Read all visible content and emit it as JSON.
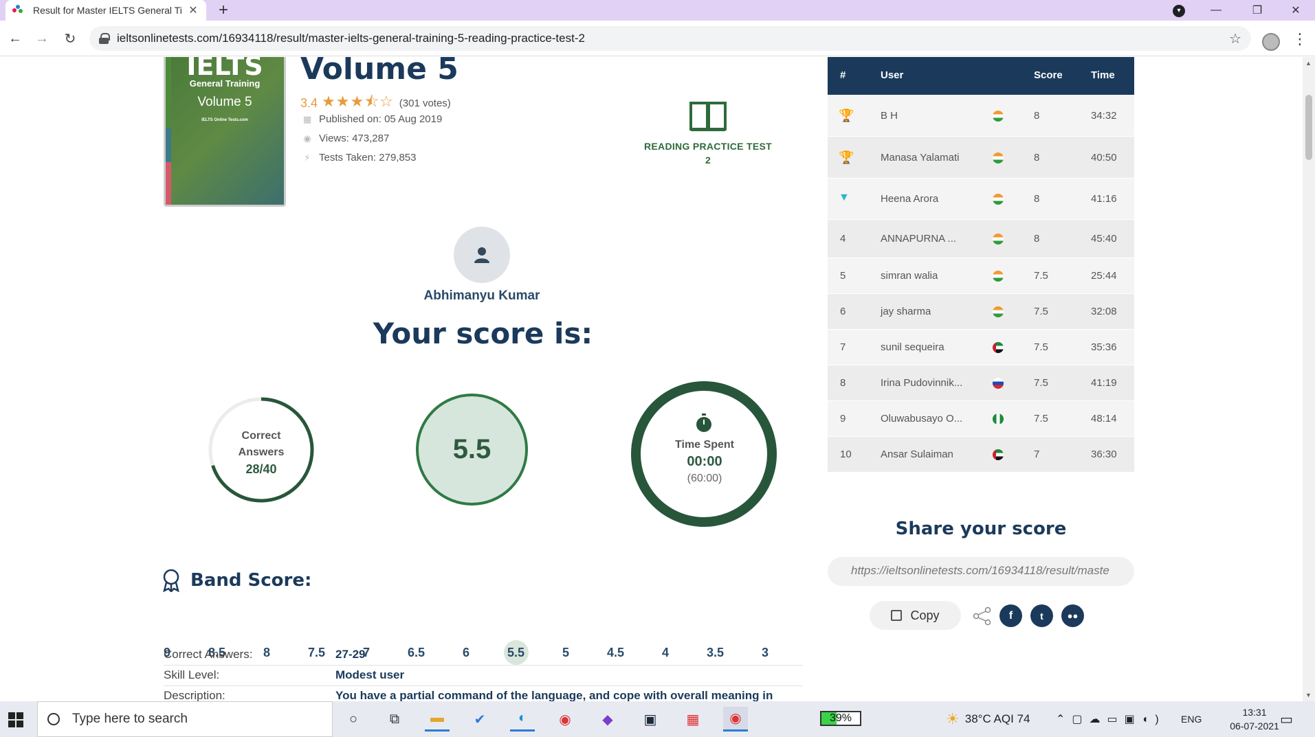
{
  "browser": {
    "tab_title": "Result for Master IELTS General Ti",
    "tab_close": "✕",
    "new_tab": "+",
    "url": "ieltsonlinetests.com/16934118/result/master-ielts-general-training-5-reading-practice-test-2"
  },
  "book": {
    "cover_title": "IELTS",
    "cover_subtitle": "General Training",
    "cover_volume": "Volume 5",
    "cover_brand": "IELTS Online Tests.com",
    "title": "Volume 5",
    "rating": "3.4",
    "rating_stars": 3.5,
    "votes": "(301 votes)",
    "published": "Published on: 05 Aug 2019",
    "views": "Views: 473,287",
    "tests_taken": "Tests Taken: 279,853"
  },
  "test_label": {
    "line1": "READING PRACTICE TEST",
    "line2": "2"
  },
  "user": {
    "name": "Abhimanyu Kumar"
  },
  "score": {
    "heading": "Your score is:",
    "correct_label_1": "Correct",
    "correct_label_2": "Answers",
    "correct_value": "28/40",
    "correct_fraction": 0.7,
    "band": "5.5",
    "time_label": "Time Spent",
    "time_value": "00:00",
    "time_limit": "(60:00)"
  },
  "band_score": {
    "title": "Band Score:",
    "values": [
      "9",
      "8.5",
      "8",
      "7.5",
      "7",
      "6.5",
      "6",
      "5.5",
      "5",
      "4.5",
      "4",
      "3.5",
      "3"
    ],
    "active": "5.5"
  },
  "details": [
    {
      "key": "Correct Answers:",
      "value": "27-29"
    },
    {
      "key": "Skill Level:",
      "value": "Modest user"
    },
    {
      "key": "Description:",
      "value": "You have a partial command of the language, and cope with overall meaning in"
    }
  ],
  "leaderboard": {
    "headers": {
      "rank": "#",
      "user": "User",
      "score": "Score",
      "time": "Time"
    },
    "rows": [
      {
        "rank": "",
        "medal": "gold",
        "user": "B H",
        "flag": "india",
        "score": "8",
        "time": "34:32"
      },
      {
        "rank": "",
        "medal": "bronze",
        "user": "Manasa Yalamati",
        "flag": "india",
        "score": "8",
        "time": "40:50"
      },
      {
        "rank": "",
        "medal": "diamond",
        "user": "Heena Arora",
        "flag": "india",
        "score": "8",
        "time": "41:16"
      },
      {
        "rank": "4",
        "medal": "",
        "user": "ANNAPURNA ...",
        "flag": "india",
        "score": "8",
        "time": "45:40"
      },
      {
        "rank": "5",
        "medal": "",
        "user": "simran walia",
        "flag": "india",
        "score": "7.5",
        "time": "25:44"
      },
      {
        "rank": "6",
        "medal": "",
        "user": "jay sharma",
        "flag": "india",
        "score": "7.5",
        "time": "32:08"
      },
      {
        "rank": "7",
        "medal": "",
        "user": "sunil sequeira",
        "flag": "uae",
        "score": "7.5",
        "time": "35:36"
      },
      {
        "rank": "8",
        "medal": "",
        "user": "Irina Pudovinnik...",
        "flag": "russia",
        "score": "7.5",
        "time": "41:19"
      },
      {
        "rank": "9",
        "medal": "",
        "user": "Oluwabusayo O...",
        "flag": "nigeria",
        "score": "7.5",
        "time": "48:14"
      },
      {
        "rank": "10",
        "medal": "",
        "user": "Ansar Sulaiman",
        "flag": "uae",
        "score": "7",
        "time": "36:30"
      }
    ]
  },
  "share": {
    "title": "Share your score",
    "url": "https://ieltsonlinetests.com/16934118/result/maste",
    "copy_label": "Copy"
  },
  "taskbar": {
    "search_placeholder": "Type here to search",
    "battery": "39%",
    "weather": "38°C  AQI 74",
    "lang": "ENG",
    "time": "13:31",
    "date": "06-07-2021"
  },
  "colors": {
    "navy": "#1b3a5b",
    "green": "#2e5a3f",
    "accent_orange": "#e79b3b"
  }
}
